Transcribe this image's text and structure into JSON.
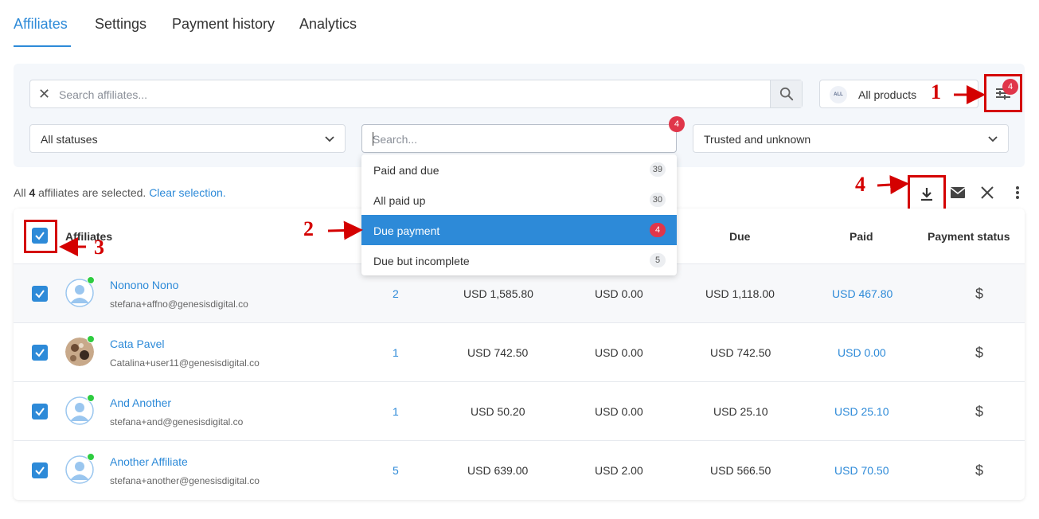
{
  "tabs": [
    "Affiliates",
    "Settings",
    "Payment history",
    "Analytics"
  ],
  "filters": {
    "search_placeholder": "Search affiliates...",
    "products_chip": "ALL",
    "products_label": "All products",
    "filter_badge": "4",
    "status_select": "All statuses",
    "payment_search_placeholder": "Search...",
    "payment_badge": "4",
    "trust_select": "Trusted and unknown"
  },
  "dropdown": [
    {
      "label": "Paid and due",
      "count": "39"
    },
    {
      "label": "All paid up",
      "count": "30"
    },
    {
      "label": "Due payment",
      "count": "4"
    },
    {
      "label": "Due but incomplete",
      "count": "5"
    }
  ],
  "selection": {
    "prefix": "All ",
    "count": "4",
    "suffix": " affiliates are selected.",
    "clear_label": "Clear selection."
  },
  "table": {
    "headers": {
      "affiliates": "Affiliates",
      "due": "Due",
      "paid": "Paid",
      "payment_status": "Payment status"
    },
    "rows": [
      {
        "name": "Nonono Nono",
        "email": "stefana+affno@genesisdigital.co",
        "count": "2",
        "col1": "USD 1,585.80",
        "col2": "USD 0.00",
        "due": "USD 1,118.00",
        "paid": "USD 467.80",
        "status": "$"
      },
      {
        "name": "Cata Pavel",
        "email": "Catalina+user11@genesisdigital.co",
        "count": "1",
        "col1": "USD 742.50",
        "col2": "USD 0.00",
        "due": "USD 742.50",
        "paid": "USD 0.00",
        "status": "$"
      },
      {
        "name": "And Another",
        "email": "stefana+and@genesisdigital.co",
        "count": "1",
        "col1": "USD 50.20",
        "col2": "USD 0.00",
        "due": "USD 25.10",
        "paid": "USD 25.10",
        "status": "$"
      },
      {
        "name": "Another Affiliate",
        "email": "stefana+another@genesisdigital.co",
        "count": "5",
        "col1": "USD 639.00",
        "col2": "USD 2.00",
        "due": "USD 566.50",
        "paid": "USD 70.50",
        "status": "$"
      }
    ]
  },
  "annotations": [
    "1",
    "2",
    "3",
    "4"
  ],
  "colors": {
    "accent": "#2d8ad8",
    "annotation": "#d40000",
    "badge": "#e0364a",
    "online": "#2ecc40"
  }
}
